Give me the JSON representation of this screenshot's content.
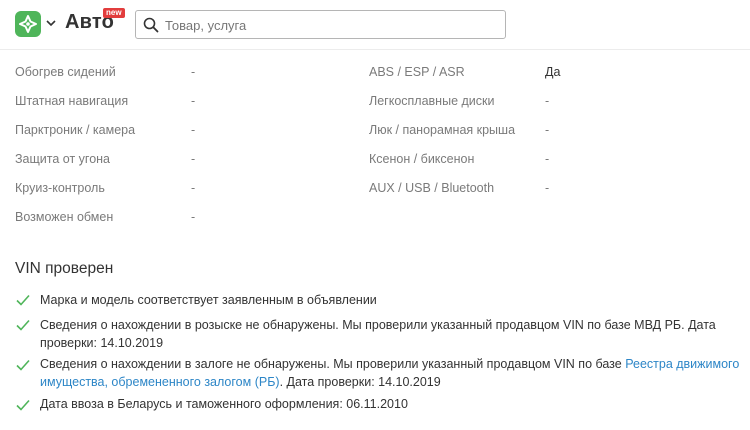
{
  "header": {
    "brand": "Авто",
    "badge": "new",
    "search_placeholder": "Товар, услуга",
    "icons": [
      "logo-icon",
      "chevron-down-icon",
      "search-icon"
    ],
    "accent_color": "#4fb55a",
    "badge_color": "#e23d3d"
  },
  "specs_left": [
    {
      "label": "Обогрев сидений",
      "value": "-"
    },
    {
      "label": "Штатная навигация",
      "value": "-"
    },
    {
      "label": "Парктроник / камера",
      "value": "-"
    },
    {
      "label": "Защита от угона",
      "value": "-"
    },
    {
      "label": "Круиз-контроль",
      "value": "-"
    },
    {
      "label": "Возможен обмен",
      "value": "-"
    }
  ],
  "specs_right": [
    {
      "label": "ABS / ESP / ASR",
      "value": "Да"
    },
    {
      "label": "Легкосплавные диски",
      "value": "-"
    },
    {
      "label": "Люк / панорамная крыша",
      "value": "-"
    },
    {
      "label": "Ксенон / биксенон",
      "value": "-"
    },
    {
      "label": "AUX / USB / Bluetooth",
      "value": "-"
    }
  ],
  "vin": {
    "title": "VIN проверен",
    "check_color": "#4fb55a",
    "checks": [
      {
        "text": "Марка и модель соответствует заявленным в объявлении"
      },
      {
        "text": "Сведения о нахождении в розыске не обнаружены. Мы проверили указанный продавцом VIN по базе МВД РБ. Дата проверки: 14.10.2019"
      },
      {
        "prefix": "Сведения о нахождении в залоге не обнаружены. Мы проверили указанный продавцом VIN по базе ",
        "link": "Реестра движимого имущества, обремененного залогом (РБ)",
        "suffix": ". Дата проверки: 14.10.2019"
      },
      {
        "text": "Дата ввоза в Беларусь и таможенного оформления: 06.11.2010"
      }
    ]
  }
}
